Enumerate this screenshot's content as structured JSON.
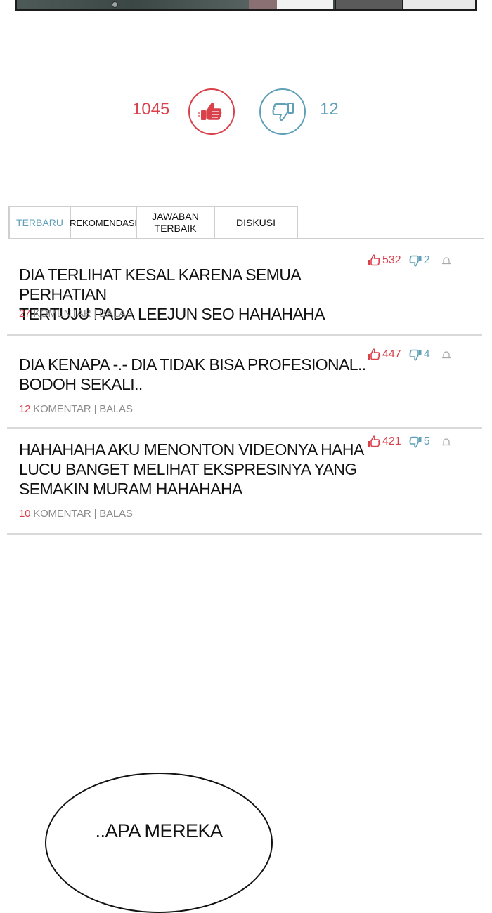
{
  "votes": {
    "like_count": "1045",
    "dislike_count": "12",
    "like_color": "#d9414b",
    "dislike_color": "#5fa0b8"
  },
  "tabs": [
    {
      "label": "TERBARU",
      "active": true
    },
    {
      "label": "REKOMENDASI",
      "active": false
    },
    {
      "label": "JAWABAN\nTERBAIK",
      "active": false
    },
    {
      "label": "DISKUSI",
      "active": false
    }
  ],
  "comments": [
    {
      "text": "DIA TERLIHAT KESAL KARENA SEMUA PERHATIAN\nTERTUJU PADA LEEJUN SEO HAHAHAHA",
      "reply_count": "27",
      "reply_label": "KOMENTAR",
      "reply_action": "BALAS",
      "likes": "532",
      "dislikes": "2"
    },
    {
      "text": "DIA KENAPA -.-  DIA TIDAK BISA PROFESIONAL..\nBODOH SEKALI..",
      "reply_count": "12",
      "reply_label": "KOMENTAR",
      "reply_action": "BALAS",
      "likes": "447",
      "dislikes": "4"
    },
    {
      "text": "HAHAHAHA AKU MENONTON VIDEONYA HAHA\nLUCU BANGET MELIHAT EKSPRESINYA YANG\nSEMAKIN MURAM HAHAHAHA",
      "reply_count": "10",
      "reply_label": "KOMENTAR",
      "reply_action": "BALAS",
      "likes": "421",
      "dislikes": "5"
    }
  ],
  "icons": {
    "like": "thumbs-up-icon",
    "dislike": "thumbs-down-icon",
    "report": "report-icon"
  },
  "comic": {
    "bubble_text": "..APA MEREKA"
  }
}
